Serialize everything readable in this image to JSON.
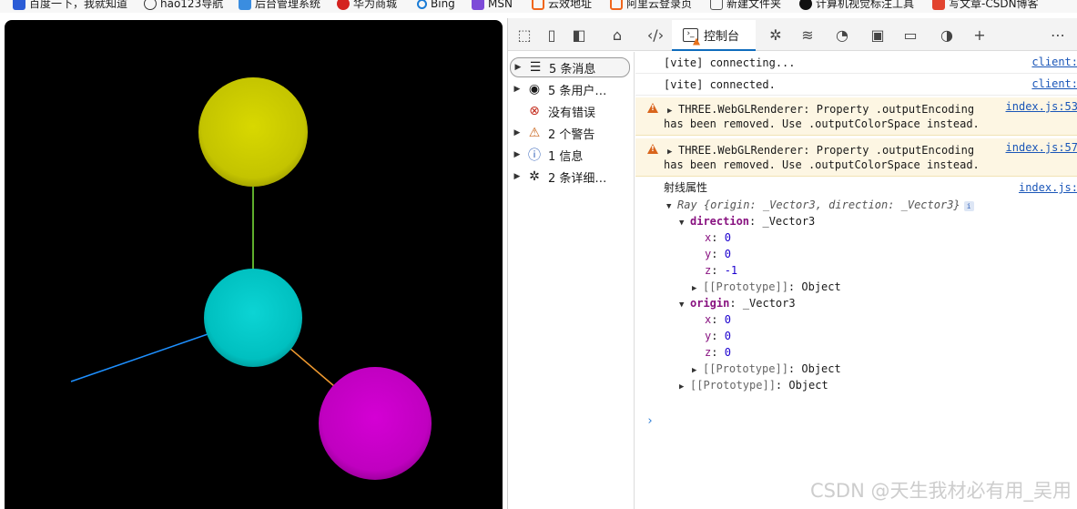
{
  "bookmarks": [
    {
      "label": "百度一下，我就知道",
      "color": "#2b5cd6"
    },
    {
      "label": "hao123导航",
      "color": "#333333"
    },
    {
      "label": "后台管理系统",
      "color": "#3a8de0"
    },
    {
      "label": "华为商城",
      "color": "#d4221f"
    },
    {
      "label": "Bing",
      "color": "#1b7cd6"
    },
    {
      "label": "MSN",
      "color": "#7d4bd8"
    },
    {
      "label": "云效地址",
      "color": "#f0661c"
    },
    {
      "label": "阿里云登录页",
      "color": "#f0661c"
    },
    {
      "label": "新建文件夹",
      "color": "#555555"
    },
    {
      "label": "计算机视觉标注工具",
      "color": "#111111"
    },
    {
      "label": "写文章-CSDN博客",
      "color": "#e2442f"
    }
  ],
  "scene": {
    "background": "#000000",
    "spheres": [
      {
        "name": "yellow",
        "color": "#cccc00"
      },
      {
        "name": "cyan",
        "color": "#00cccc"
      },
      {
        "name": "magenta",
        "color": "#cc00cc"
      }
    ],
    "rays": [
      {
        "name": "green",
        "color": "#7ee83a"
      },
      {
        "name": "blue",
        "color": "#1e90ff"
      },
      {
        "name": "orange",
        "color": "#f09a30"
      }
    ]
  },
  "devtools": {
    "console_tab_label": "控制台",
    "toolbar_icons": [
      "inspect-icon",
      "device-icon",
      "dock-icon",
      "home-icon",
      "elements-icon",
      "console-icon",
      "bug-icon",
      "network-icon",
      "performance-icon",
      "memory-icon",
      "application-icon",
      "lighthouse-icon",
      "add-icon",
      "more-icon"
    ],
    "sidebar": [
      {
        "label": "5 条消息",
        "icon": "list-icon",
        "glyph": "☰",
        "arrow": true,
        "active": true
      },
      {
        "label": "5 条用户…",
        "icon": "user-icon",
        "glyph": "◉",
        "arrow": true,
        "active": false
      },
      {
        "label": "没有错误",
        "icon": "error-icon",
        "glyph": "⊗",
        "arrow": false,
        "active": false
      },
      {
        "label": "2 个警告",
        "icon": "warning-icon",
        "glyph": "⚠",
        "arrow": true,
        "active": false
      },
      {
        "label": "1 信息",
        "icon": "info-icon",
        "glyph": "ⓘ",
        "arrow": true,
        "active": false
      },
      {
        "label": "2 条详细…",
        "icon": "verbose-icon",
        "glyph": "✲",
        "arrow": true,
        "active": false
      }
    ],
    "messages": [
      {
        "text": "[vite] connecting...",
        "source": "client:"
      },
      {
        "text": "[vite] connected.",
        "source": "client:"
      },
      {
        "line1": "THREE.WebGLRenderer: Property .outputEncoding",
        "line2": "has been removed. Use .outputColorSpace instead.",
        "source": "index.js:53"
      },
      {
        "line1": "THREE.WebGLRenderer: Property .outputEncoding",
        "line2": "has been removed. Use .outputColorSpace instead.",
        "source": "index.js:57"
      },
      {
        "text": "射线属性",
        "source": "index.js:"
      }
    ],
    "ray_object": {
      "summary": "Ray {origin: _Vector3, direction: _Vector3}",
      "info_badge": "i",
      "direction_key": "direction",
      "direction_type": "_Vector3",
      "direction": {
        "x": "0",
        "y": "0",
        "z": "-1"
      },
      "origin_key": "origin",
      "origin_type": "_Vector3",
      "origin": {
        "x": "0",
        "y": "0",
        "z": "0"
      },
      "prototype_key": "[[Prototype]]",
      "prototype_value": "Object"
    },
    "prompt": "›"
  },
  "watermark": "CSDN @天生我材必有用_吴用"
}
